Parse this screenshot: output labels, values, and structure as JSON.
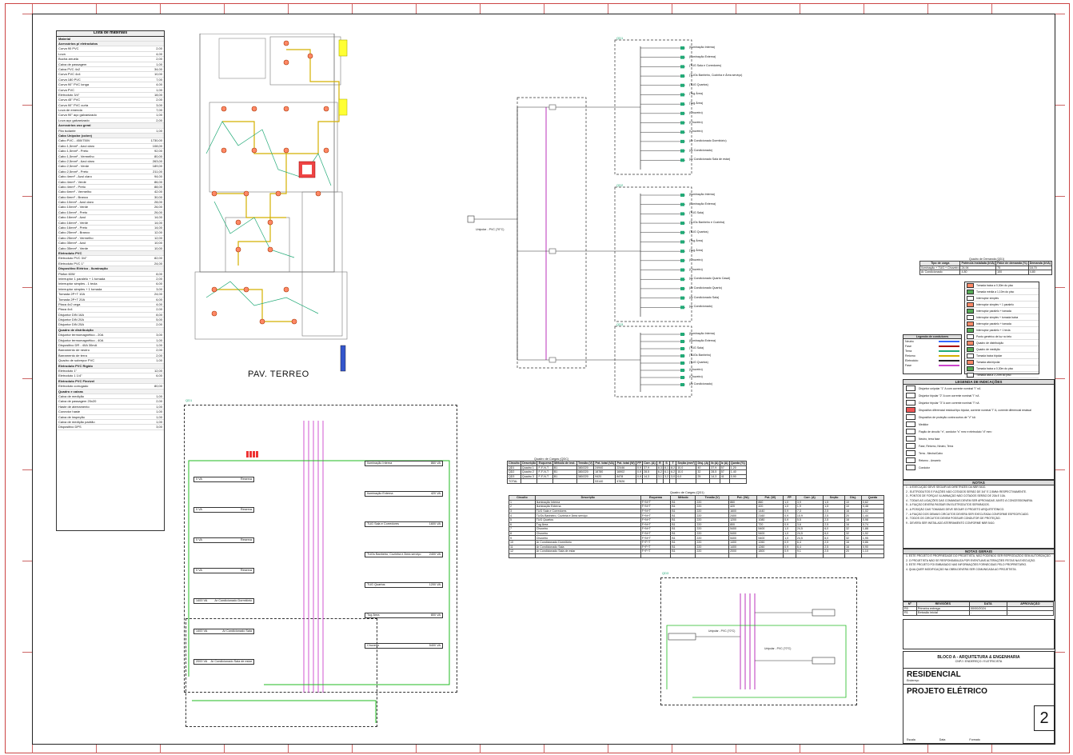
{
  "plan": {
    "label": "PAV. TERREO"
  },
  "materials": {
    "title": "Lista de materiais",
    "header": "Material",
    "rows": [
      [
        "Acessórios p/ eletrodutos",
        ""
      ],
      [
        "Curva 90 PVC",
        "2,00"
      ],
      [
        "Luva",
        "4,00"
      ],
      [
        "Bucha arruela",
        "2,00"
      ],
      [
        "Caixa de passagem",
        "1,00"
      ],
      [
        "Caixa PVC 4x2",
        "34,00"
      ],
      [
        "Curva PVC 4x4",
        "10,00"
      ],
      [
        "Curva 180 PVC",
        "7,00"
      ],
      [
        "Curva 90° PVC longa",
        "4,00"
      ],
      [
        "Curva PVC",
        "1,00"
      ],
      [
        "Eletroduto 3/4\"",
        "18,00"
      ],
      [
        "Curva 45° PVC",
        "2,00"
      ],
      [
        "Curva 90° PVC curta",
        "3,00"
      ],
      [
        "Luva de emenda",
        "7,00"
      ],
      [
        "Curva 90° aço galvanizado",
        "1,00"
      ],
      [
        "Luva aço galvanizado",
        "2,00"
      ],
      [
        "Acessórios uso geral",
        ""
      ],
      [
        "Fita isolante",
        "1,00"
      ],
      [
        "Cabo Unipolar (cobre)",
        ""
      ],
      [
        "Cabo PVC - 450/750V",
        "1730,00"
      ],
      [
        "Cabo 1,5mm² - Azul claro",
        "108,00"
      ],
      [
        "Cabo 1,5mm² - Preto",
        "92,00"
      ],
      [
        "Cabo 1,5mm² - Vermelho",
        "80,00"
      ],
      [
        "Cabo 2,5mm² - Azul claro",
        "263,00"
      ],
      [
        "Cabo 2,5mm² - Verde",
        "189,00"
      ],
      [
        "Cabo 2,5mm² - Preto",
        "211,00"
      ],
      [
        "Cabo 4mm² - Azul claro",
        "94,00"
      ],
      [
        "Cabo 4mm² - Verde",
        "86,00"
      ],
      [
        "Cabo 4mm² - Preto",
        "88,00"
      ],
      [
        "Cabo 6mm² - Vermelho",
        "42,00"
      ],
      [
        "Cabo 6mm² - Branco",
        "30,00"
      ],
      [
        "Cabo 10mm² - Azul claro",
        "28,00"
      ],
      [
        "Cabo 10mm² - Verde",
        "26,00"
      ],
      [
        "Cabo 10mm² - Preto",
        "26,00"
      ],
      [
        "Cabo 16mm² - Azul",
        "14,00"
      ],
      [
        "Cabo 16mm² - Verde",
        "14,00"
      ],
      [
        "Cabo 16mm² - Preto",
        "14,00"
      ],
      [
        "Cabo 25mm² - Branco",
        "12,00"
      ],
      [
        "Cabo 25mm² - Vermelho",
        "12,00"
      ],
      [
        "Cabo 35mm² - Azul",
        "10,00"
      ],
      [
        "Cabo 35mm² - Verde",
        "10,00"
      ],
      [
        "Eletroduto PVC",
        ""
      ],
      [
        "Eletroduto PVC 3/4\"",
        "82,00"
      ],
      [
        "Eletroduto PVC 1\"",
        "24,00"
      ],
      [
        "Dispositivo Elétrico - Iluminação",
        ""
      ],
      [
        "Plafon 60W",
        "8,00"
      ],
      [
        "Interruptor 1 paralelo + 1 tomada",
        "2,00"
      ],
      [
        "Interruptor simples - 1 tecla",
        "6,00"
      ],
      [
        "Interruptor simples + 1 tomada",
        "3,00"
      ],
      [
        "Tomada 2P+T 10A",
        "24,00"
      ],
      [
        "Tomada 2P+T 20A",
        "6,00"
      ],
      [
        "Placa 4x2 cega",
        "4,00"
      ],
      [
        "Placa 4x4",
        "2,00"
      ],
      [
        "Disjuntor DIN 16A",
        "8,00"
      ],
      [
        "Disjuntor DIN 20A",
        "5,00"
      ],
      [
        "Disjuntor DIN 25A",
        "2,00"
      ],
      [
        "Quadro de distribuição",
        ""
      ],
      [
        "Disjuntor termomagnético - 20A",
        "3,00"
      ],
      [
        "Disjuntor termomagnético - 40A",
        "1,00"
      ],
      [
        "Dispositivo DR - 40A 30mA",
        "1,00"
      ],
      [
        "Barramento de neutro",
        "2,00"
      ],
      [
        "Barramento de terra",
        "2,00"
      ],
      [
        "Quadro de sobrepor PVC",
        "1,00"
      ],
      [
        "Eletroduto PVC Rígido",
        ""
      ],
      [
        "Eletroduto 1\"",
        "12,00"
      ],
      [
        "Eletroduto 1 1/4\"",
        "6,00"
      ],
      [
        "Eletroduto PVC Flexível",
        ""
      ],
      [
        "Eletroduto corrugado",
        "80,00"
      ],
      [
        "Quadro e caixas",
        ""
      ],
      [
        "Caixa de medição",
        "1,00"
      ],
      [
        "Caixa de passagem 20x20",
        "2,00"
      ],
      [
        "Haste de aterramento",
        "1,00"
      ],
      [
        "Conector haste",
        "1,00"
      ],
      [
        "Caixa de inspeção",
        "1,00"
      ],
      [
        "Caixa de medição padrão",
        "1,00"
      ],
      [
        "Dispositivo DPS",
        "3,00"
      ]
    ]
  },
  "qdc_tables": {
    "summary_title": "Quadro de Cargas (QDC)",
    "summary_headers": [
      "Circuito",
      "Descrição",
      "Esquema",
      "Método de inst.",
      "Tensão (V)",
      "Pot. total (VA)",
      "Pot. total (W)",
      "FP",
      "Corr. (A)",
      "R",
      "S",
      "T",
      "Seção (mm²)",
      "Disj. (A)",
      "Ib (A)",
      "Iz (A)",
      "Queda (%)"
    ],
    "summary_rows": [
      [
        "QD1",
        "Quadro 1",
        "F-F-N-T",
        "B1",
        "380/220",
        "24940",
        "22446",
        "0,9",
        "37,9",
        "8,3",
        "8,1",
        "8,2",
        "10,0",
        "40",
        "37,9",
        "57",
        "1,20"
      ],
      [
        "QD2",
        "Quadro 2",
        "F-F-N-T",
        "B1",
        "380/220",
        "18780",
        "16902",
        "0,9",
        "28,5",
        "6,2",
        "6,1",
        "6,2",
        "10,0",
        "32",
        "28,5",
        "57",
        "1,40"
      ],
      [
        "QD3",
        "Quadro 3",
        "F-F-N-T",
        "B1",
        "380/220",
        "9420",
        "8478",
        "0,9",
        "14,3",
        "3,1",
        "3,2",
        "3,0",
        "6,0",
        "25",
        "14,3",
        "41",
        "0,90"
      ],
      [
        "TOTAL",
        "",
        "",
        "",
        "",
        "53140",
        "47826",
        "",
        "",
        "",
        "",
        "",
        "",
        "",
        "",
        "",
        ""
      ]
    ],
    "circuits_title": "Quadro de Cargas (QD1)",
    "circuit_headers": [
      "Circuito",
      "Descrição",
      "Esquema",
      "Método",
      "Tensão (V)",
      "Pot. (VA)",
      "Pot. (W)",
      "FP",
      "Corr. (A)",
      "Seção",
      "Disj.",
      "Queda"
    ],
    "circuit_rows": [
      [
        "1",
        "Iluminação Interna",
        "F+N+T",
        "B1",
        "220",
        "860",
        "860",
        "1,0",
        "3,9",
        "1,5",
        "10",
        "0,62"
      ],
      [
        "2",
        "Iluminação Externa",
        "F+N+T",
        "B1",
        "220",
        "420",
        "420",
        "1,0",
        "1,9",
        "1,5",
        "10",
        "0,48"
      ],
      [
        "3",
        "TUG Sala e Corredores",
        "F+N+T",
        "B1",
        "220",
        "1600",
        "1440",
        "0,9",
        "7,3",
        "2,5",
        "16",
        "1,02"
      ],
      [
        "4",
        "TUGs Banheiro, Cozinha e Área serviço",
        "F+N+T",
        "B1",
        "220",
        "2400",
        "2160",
        "0,9",
        "10,9",
        "2,5",
        "20",
        "1,44"
      ],
      [
        "5",
        "TUG Quartos",
        "F+N+T",
        "B1",
        "220",
        "1200",
        "1080",
        "0,9",
        "5,5",
        "2,5",
        "16",
        "0,98"
      ],
      [
        "6",
        "Tug Área",
        "F+N+T",
        "B1",
        "220",
        "800",
        "720",
        "0,9",
        "3,6",
        "2,5",
        "16",
        "0,74"
      ],
      [
        "7",
        "Chuveiro",
        "F+N+T",
        "B1",
        "220",
        "5400",
        "5400",
        "1,0",
        "24,5",
        "6,0",
        "32",
        "1,88"
      ],
      [
        "8",
        "Chuveiro",
        "F+N+T",
        "B1",
        "220",
        "5400",
        "5400",
        "1,0",
        "24,5",
        "6,0",
        "32",
        "1,92"
      ],
      [
        "9",
        "Chuveiro",
        "F+N+T",
        "B1",
        "220",
        "5400",
        "5400",
        "1,0",
        "24,5",
        "6,0",
        "32",
        "1,95"
      ],
      [
        "10",
        "Ar Condicionado Dormitório",
        "F+F+T",
        "B1",
        "220",
        "1400",
        "1260",
        "0,9",
        "6,4",
        "2,5",
        "16",
        "0,86"
      ],
      [
        "11",
        "Ar Condicionado Sala",
        "F+F+T",
        "B1",
        "220",
        "1400",
        "1260",
        "0,9",
        "6,4",
        "2,5",
        "16",
        "0,90"
      ],
      [
        "12",
        "Ar Condicionado Sala de estar",
        "F+F+T",
        "B1",
        "220",
        "2000",
        "1800",
        "0,9",
        "9,1",
        "2,5",
        "20",
        "1,10"
      ],
      [
        "",
        "",
        "",
        "",
        "",
        "",
        "",
        "",
        "",
        "",
        "",
        ""
      ]
    ]
  },
  "qdc_panels": [
    {
      "title": "QD1",
      "circuits": [
        "(Iluminação Interna)",
        "(Iluminação Externa)",
        "(TUG Sala e Corredores)",
        "(TUGs Banheiro, Cozinha e Área serviço)",
        "(TUG Quartos)",
        "(Tug Área)",
        "(Tug Área)",
        "(Chuveiro)",
        "(Chuveiro)",
        "(Chuveiro)",
        "(Ar Condicionado Dormitório)",
        "(Ar Condicionado)",
        "(Ar Condicionado Sala de estar)"
      ]
    },
    {
      "title": "QD2",
      "circuits": [
        "(Iluminação Interna)",
        "(Iluminação Externa)",
        "(TUG Sala)",
        "(TUGs Banheiro e Cozinha)",
        "(TUG Quartos)",
        "(Tug Área)",
        "(Tug Área)",
        "(Chuveiro)",
        "(Chuveiro)",
        "(Ar Condicionado Quarto Casal)",
        "(Ar Condicionado Quarto)",
        "(Ar Condicionado Sala)",
        "(Ar Condicionado)"
      ]
    },
    {
      "title": "QD3",
      "circuits": [
        "(Iluminação Interna)",
        "(Iluminação Externa)",
        "(TUG Sala)",
        "(TUGs Banheiro)",
        "(TUG Quartos)",
        "(Chuveiro)",
        "(Chuveiro)",
        "(Ar Condicionado)"
      ]
    }
  ],
  "main_label": "Unipolar - PVC (70°C)",
  "qd_detail": {
    "title": "QD1",
    "circuit_labels": [
      "Iluminação Interna",
      "Iluminação Externa",
      "TUG Sala e Corredores",
      "TUGs Banheiro, Cozinha e Área serviço",
      "TUG Quartos",
      "Tug Área",
      "Chuveiro",
      "Chuveiro",
      "Chuveiro"
    ],
    "left_labels": [
      "Reserva",
      "Reserva",
      "Reserva",
      "Reserva",
      "Ar Condicionado Dormitório",
      "Ar Condicionado Sala",
      "Ar Condicionado Sala de estar"
    ],
    "power_values": [
      "860 VA",
      "420 VA",
      "1600 VA",
      "2400 VA",
      "1200 VA",
      "800 VA",
      "5400 VA"
    ],
    "left_values": [
      "0 VA",
      "0 VA",
      "0 VA",
      "0 VA",
      "1400 VA",
      "1400 VA",
      "2000 VA"
    ]
  },
  "demand": {
    "title": "Quadro de Demanda (QD1)",
    "headers": [
      "Tipo de carga",
      "Potência instalada (kVA)",
      "Fator de demanda (%)",
      "Demanda (kVA)"
    ],
    "rows": [
      [
        "Iluminação + TUG + Chuveiro",
        "24,94",
        "75",
        "18,70"
      ],
      [
        "Ar Condicionado",
        "4,80",
        "100",
        "4,80"
      ]
    ]
  },
  "legend_cables": {
    "title": "Legenda de condutores",
    "items": [
      "Neutro",
      "Fase",
      "Terra",
      "Retorno",
      "Eletroduto",
      "Fase"
    ]
  },
  "legend_devices": {
    "items": [
      "Tomada baixa a 0,30m do piso",
      "Tomada média a 1,10m do piso",
      "Interruptor simples",
      "Interruptor simples + 1 paralelo",
      "Interruptor paralelo + tomada",
      "Interruptor simples + tomada baixa",
      "Interruptor paralelo + tomada",
      "Interruptor paralelo + 1 tecla",
      "Ponto genérico de luz no teto",
      "Quadro de distribuição",
      "Quadro de medição",
      "Tomada baixa bipolar",
      "Tomada alta bipolar",
      "Tomada baixa a 0,30m do piso",
      "Tomada alta a 2,20m do piso",
      "Tomada baixa a 0,30m do piso"
    ]
  },
  "legend_symbols": {
    "title": "LEGENDA DE INDICAÇÕES",
    "items": [
      "Disjuntor unipolar \"1\" A com corrente nominal \"I\" nA",
      "Disjuntor bipolar \"2\" A com corrente nominal \"I\" nA",
      "Disjuntor tripolar \"3\" A com corrente nominal \"I\" nA",
      "Dispositivo diferencial residual tipo bipolar, corrente nominal \"I\" A, corrente diferencial residual",
      "Dispositivo de proteção contra surtos de \"V\" kA",
      "Medidor",
      "Fiação de circuito \"n\", condutor \"s\" mm² e eletroduto \"d\" mm²",
      "Neutro, terra fase",
      "Fase, Retorno, Neutro, Terra",
      "Terra - Mecha/Cabo",
      "Retorno - Amarelo",
      "Condutor"
    ]
  },
  "notes": {
    "title": "NOTAS",
    "items": [
      "1 - A EXECUÇÃO DEVE SEGUIR AS DIRETRIZES DA NBR 5410.",
      "2 - ELETRODUTOS E FIAÇÕES NÃO COTADOS SERÃO DE 3/4\" E 2,5MM² RESPECTIVAMENTE.",
      "3 - PONTOS DE FORÇA E ILUMINAÇÃO NÃO COTADOS SERÃO DE 20A E 10A.",
      "4 - TODAS AS LIGAÇÕES DAS COMANDAS DEVEM SER APROVADAS JUNTO À CONCESSIONÁRIA.",
      "5 - A FIAÇÃO DEVERÁ PASSAR EM ELETRODUTOS SEPARADOS.",
      "6 - A POSIÇÃO DAS TOMADAS DEVE SEGUIR O PROJETO ARQUITETÔNICO.",
      "7 - A FIAÇÃO DOS DEMAIS CIRCUITOS DEVERÁ SER EXECUTADA CONFORME ESPECIFICADO.",
      "8 - TODOS OS CIRCUITOS DEVEM POSSUIR CONDUTOR DE PROTEÇÃO.",
      "9 - DEVERÁ SER INSTALADO ATERRAMENTO CONFORME NBR 5410."
    ]
  },
  "general_notes": {
    "title": "NOTAS GERAIS",
    "items": [
      "1. ESTE PROJETO É PROPRIEDADE DO PROJETISTA, NÃO PODENDO SER REPRODUZIDO SEM AUTORIZAÇÃO.",
      "2. O PROJETISTA NÃO SE RESPONSABILIZA POR EVENTUAIS ALTERAÇÕES FEITAS NA EXECUÇÃO.",
      "3. ESTE PROJETO FOI EMBASADO NAS INFORMAÇÕES FORNECIDAS PELO PROPRIETÁRIO.",
      "4. QUALQUER MODIFICAÇÃO NA OBRA DEVERÁ SER COMUNICADA AO PROJETISTA."
    ]
  },
  "revisions": {
    "headers": [
      "Nº",
      "REVISÕES",
      "DATA",
      "APROVAÇÃO"
    ],
    "rows": [
      [
        "R0",
        "Primeira entrega",
        "00/00/2024",
        "-"
      ],
      [
        "R1",
        "Emissão inicial",
        "-",
        "-"
      ]
    ]
  },
  "title_block": {
    "company": "BLOCO A - ARQUITETURA & ENGENHARIA",
    "company_sub": "CNPJ / ENDEREÇO / ELETRICISTA",
    "client_type": "RESIDENCIAL",
    "client_sub": "Endereço",
    "project": "PROJETO ELÉTRICO",
    "sheet": "2",
    "scale_label": "Escala",
    "date_label": "Data",
    "format_label": "Formato"
  },
  "qd3_panel": {
    "title": "QD3",
    "labels": [
      "Unipolar - PVC (70°C)",
      "Unipolar - PVC (70°C)"
    ]
  }
}
